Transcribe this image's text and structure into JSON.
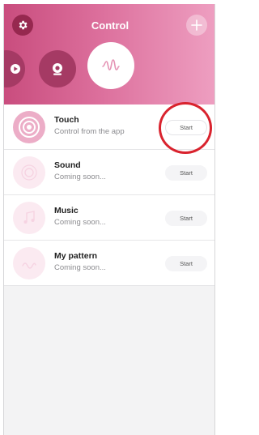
{
  "header": {
    "title": "Control",
    "settings_icon": "gear-icon",
    "add_icon": "plus-icon"
  },
  "modes": [
    {
      "icon": "play-icon"
    },
    {
      "icon": "camera-icon"
    },
    {
      "icon": "wave-icon"
    }
  ],
  "items": [
    {
      "name": "Touch",
      "subtitle": "Control from the app",
      "button": "Start",
      "icon": "touch-icon"
    },
    {
      "name": "Sound",
      "subtitle": "Coming soon...",
      "button": "Start",
      "icon": "sound-icon"
    },
    {
      "name": "Music",
      "subtitle": "Coming soon...",
      "button": "Start",
      "icon": "music-icon"
    },
    {
      "name": "My pattern",
      "subtitle": "Coming soon...",
      "button": "Start",
      "icon": "pattern-icon"
    }
  ],
  "colors": {
    "accent": "#c94d7e",
    "dark_accent": "#96284f",
    "highlight": "#d9232e"
  }
}
